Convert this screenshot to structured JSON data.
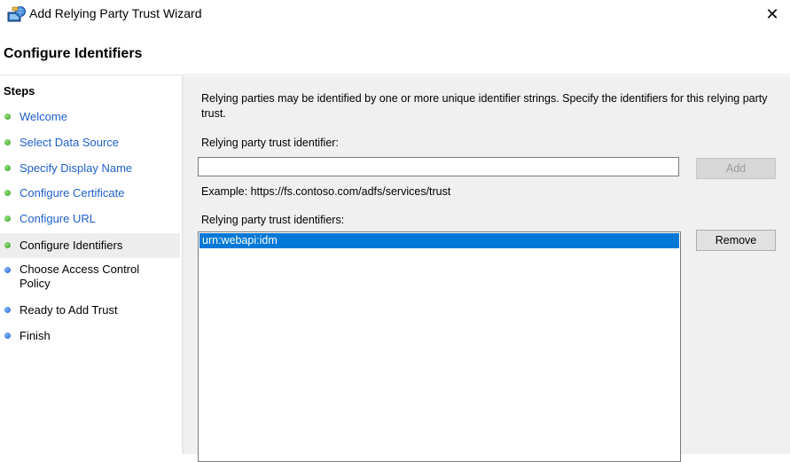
{
  "window": {
    "title": "Add Relying Party Trust Wizard",
    "icon": "adfs-wizard-icon",
    "close_glyph": "✕"
  },
  "header": {
    "title": "Configure Identifiers"
  },
  "steps": {
    "heading": "Steps",
    "items": [
      {
        "label": "Welcome",
        "state": "done"
      },
      {
        "label": "Select Data Source",
        "state": "done"
      },
      {
        "label": "Specify Display Name",
        "state": "done"
      },
      {
        "label": "Configure Certificate",
        "state": "done"
      },
      {
        "label": "Configure URL",
        "state": "done"
      },
      {
        "label": "Configure Identifiers",
        "state": "current"
      },
      {
        "label": "Choose Access Control Policy",
        "state": "todo"
      },
      {
        "label": "Ready to Add Trust",
        "state": "todo"
      },
      {
        "label": "Finish",
        "state": "todo"
      }
    ]
  },
  "content": {
    "intro": "Relying parties may be identified by one or more unique identifier strings. Specify the identifiers for this relying party trust.",
    "identifier_label": "Relying party trust identifier:",
    "identifier_value": "",
    "add_label": "Add",
    "example": "Example: https://fs.contoso.com/adfs/services/trust",
    "identifiers_label": "Relying party trust identifiers:",
    "identifiers": [
      "urn:webapi:idm"
    ],
    "remove_label": "Remove"
  },
  "colors": {
    "link": "#1f5fcc",
    "done_dot": "#3a9a2a",
    "todo_dot": "#1f5fcc",
    "selection": "#0078d7",
    "content_bg": "#f0f0f0"
  }
}
